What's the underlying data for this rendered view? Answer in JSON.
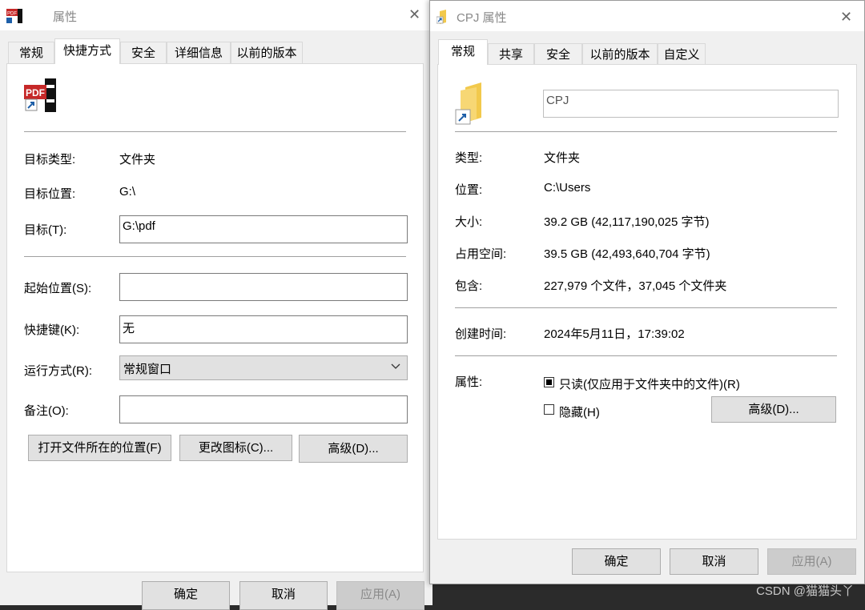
{
  "left": {
    "title": "属性",
    "tabs": [
      "常规",
      "快捷方式",
      "安全",
      "详细信息",
      "以前的版本"
    ],
    "active_tab": "快捷方式",
    "icon_text": "PDF",
    "rows": [
      {
        "label": "目标类型:",
        "value": "文件夹"
      },
      {
        "label": "目标位置:",
        "value": "G:\\"
      }
    ],
    "target_label": "目标(T):",
    "target_value": "G:\\pdf",
    "start_label": "起始位置(S):",
    "start_value": "",
    "hotkey_label": "快捷键(K):",
    "hotkey_value": "无",
    "run_label": "运行方式(R):",
    "run_value": "常规窗口",
    "comment_label": "备注(O):",
    "comment_value": "",
    "buttons": [
      "打开文件所在的位置(F)",
      "更改图标(C)...",
      "高级(D)..."
    ],
    "footer": [
      "确定",
      "取消",
      "应用(A)"
    ]
  },
  "right": {
    "title": "CPJ 属性",
    "tabs": [
      "常规",
      "共享",
      "安全",
      "以前的版本",
      "自定义"
    ],
    "active_tab": "常规",
    "name_value": "CPJ",
    "rows": [
      {
        "label": "类型:",
        "value": "文件夹"
      },
      {
        "label": "位置:",
        "value": "C:\\Users"
      },
      {
        "label": "大小:",
        "value": "39.2 GB (42,117,190,025 字节)"
      },
      {
        "label": "占用空间:",
        "value": "39.5 GB (42,493,640,704 字节)"
      },
      {
        "label": "包含:",
        "value": "227,979 个文件，37,045 个文件夹"
      }
    ],
    "created_label": "创建时间:",
    "created_value": "2024年5月11日，17:39:02",
    "attr_label": "属性:",
    "readonly_label": "只读(仅应用于文件夹中的文件)(R)",
    "readonly_checked": true,
    "hidden_label": "隐藏(H)",
    "hidden_checked": false,
    "advanced_button": "高级(D)...",
    "footer": [
      "确定",
      "取消",
      "应用(A)"
    ]
  },
  "watermark": "CSDN @猫猫头丫"
}
